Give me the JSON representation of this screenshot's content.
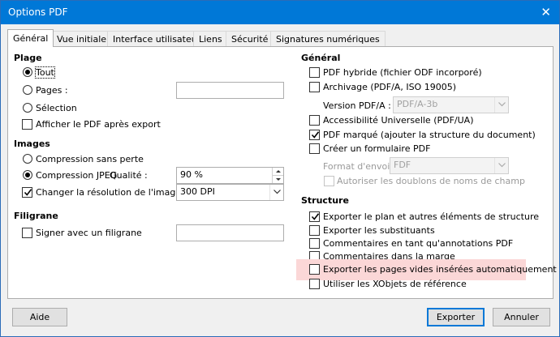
{
  "window": {
    "title": "Options PDF",
    "close_glyph": "✕"
  },
  "tabs": [
    {
      "label": "Général",
      "active": true
    },
    {
      "label": "Vue initiale"
    },
    {
      "label": "Interface utilisateur"
    },
    {
      "label": "Liens"
    },
    {
      "label": "Sécurité"
    },
    {
      "label": "Signatures numériques"
    }
  ],
  "plage": {
    "heading": "Plage",
    "tout": "Tout",
    "pages": "Pages :",
    "pages_value": "",
    "selection": "Sélection",
    "afficher": "Afficher le PDF après export"
  },
  "images": {
    "heading": "Images",
    "sans_perte": "Compression sans perte",
    "jpeg": "Compression JPEG",
    "qualite": "Qualité :",
    "qualite_value": "90 %",
    "changer": "Changer la résolution de l'image en :",
    "resolution_value": "300 DPI"
  },
  "filigrane": {
    "heading": "Filigrane",
    "signer": "Signer avec un filigrane",
    "value": ""
  },
  "general": {
    "heading": "Général",
    "hybride": "PDF hybride (fichier ODF incorporé)",
    "archivage": "Archivage (PDF/A, ISO 19005)",
    "version_label": "Version PDF/A :",
    "version_value": "PDF/A-3b",
    "accessibilite": "Accessibilité Universelle (PDF/UA)",
    "marque": "PDF marqué (ajouter la structure du document)",
    "formulaire": "Créer un formulaire PDF",
    "format_label": "Format d'envoi :",
    "format_value": "FDF",
    "doublons": "Autoriser les doublons de noms de champ"
  },
  "structure": {
    "heading": "Structure",
    "plan": "Exporter le plan et autres éléments de structure",
    "substituants": "Exporter les substituants",
    "commentaires": "Commentaires en tant qu'annotations PDF",
    "marge": "Commentaires dans la marge",
    "pages_vides": "Exporter les pages vides insérées automatiquement",
    "xobjets": "Utiliser les XObjets de référence"
  },
  "buttons": {
    "aide": "Aide",
    "exporter": "Exporter",
    "annuler": "Annuler"
  },
  "colors": {
    "titlebar": "#0078d7",
    "highlight": "#fbd7d7",
    "primary_border": "#0078d7"
  }
}
